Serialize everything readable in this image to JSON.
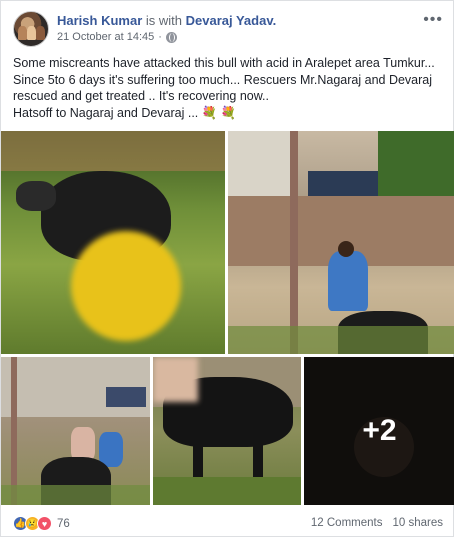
{
  "post": {
    "author": "Harish Kumar",
    "with_text": "is with",
    "tagged": "Devaraj Yadav.",
    "timestamp": "21 October at 14:45",
    "dot": "·",
    "more_icon": "•••",
    "text_lines": [
      "Some miscreants have attacked this bull with acid in Aralepet area Tumkur...",
      "Since 5to 6 days it's suffering too much... Rescuers Mr.Nagaraj and Devaraj",
      "rescued and get treated .. It's recovering now..",
      "Hatsoff to Nagaraj and Devaraj ... 💐 💐"
    ],
    "more_photos": "+2"
  },
  "footer": {
    "reaction_icons": [
      "like-icon",
      "sad-icon",
      "love-icon"
    ],
    "reaction_glyphs": [
      "👍",
      "😢",
      "♥"
    ],
    "reaction_count": "76",
    "comments": "12 Comments",
    "shares": "10 shares"
  },
  "colors": {
    "link_blue": "#385898",
    "meta_gray": "#606770",
    "like_blue": "#4267b2",
    "love_red": "#f25268",
    "sad_yellow": "#f7b125"
  }
}
